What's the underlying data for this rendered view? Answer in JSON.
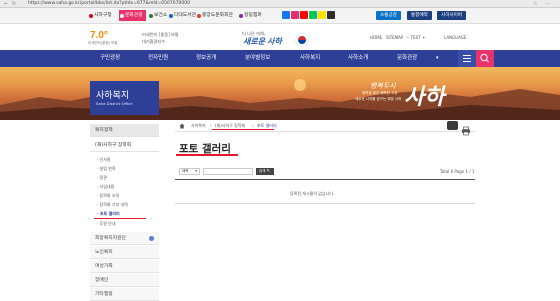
{
  "browser": {
    "url": "https://www.saha.go.kr/portal/bbs/list.do?ptIdx=677&mId=0507070000"
  },
  "quicklinks": [
    {
      "label": "사하구청",
      "color": "#d9001b"
    },
    {
      "label": "문화관광",
      "color": "#ffffff"
    },
    {
      "label": "보건소",
      "color": "#2e7d32"
    },
    {
      "label": "다대도서관",
      "color": "#1565c0"
    },
    {
      "label": "중앙도문화회관",
      "color": "#e53935"
    },
    {
      "label": "힐링캠퍼",
      "color": "#8e24aa"
    }
  ],
  "right_tabs": [
    {
      "label": "소통공감",
      "color": "#0a73c8"
    },
    {
      "label": "통합예약",
      "color": "#1c3f7f"
    },
    {
      "label": "사하사이버",
      "color": "#1c3f7f"
    }
  ],
  "header": {
    "temperature": "7.0°",
    "air_quality_label": "미세먼지(좋음) 보통",
    "weather_line1": "미세먼지 [좋음] 보통",
    "weather_line2": "대기환경지수",
    "slogan_small": "더 나은 미래,",
    "slogan_main": "새로운 사하",
    "utility": [
      "HOME",
      "SITEMAP",
      "TEXT",
      "LANGUAGE"
    ]
  },
  "gnb": [
    "구민광장",
    "전자민원",
    "정보공개",
    "분야별정보",
    "사하복지",
    "사하소개",
    "문화관광"
  ],
  "banner": {
    "section_title": "사하복지",
    "section_subtitle": "Saha District Office",
    "phrase": "행복두시",
    "brand": "사하",
    "sub_line1": "행복을 좋은 행복한 고장",
    "sub_line2": "새로운 사하를 꿈꾸는 희망 사하"
  },
  "lnb": {
    "head": "복지정책",
    "main_items": [
      "(재)사하구 장학회",
      "희망복지지원단",
      "노인복지",
      "여성가족",
      "장애인",
      "기타행정"
    ],
    "sub_items": [
      "인사말",
      "설립 연혁",
      "정관",
      "사업내용",
      "장학회 조직",
      "장학회 기부 내역",
      "포토 갤러리",
      "후원 안내"
    ]
  },
  "breadcrumb": [
    "사하복지",
    "(재)사하구 장학회",
    "포토 갤러리"
  ],
  "page": {
    "title": "포토 갤러리",
    "search_select": "제목",
    "search_button": "검색 🔍",
    "total": "Total 0 Page 1 / 1",
    "empty_message": "등록된 게시물이 없습니다."
  },
  "colors": {
    "navy": "#2e3f98",
    "pink": "#e8326b",
    "annotation_red": "#e4192a"
  }
}
